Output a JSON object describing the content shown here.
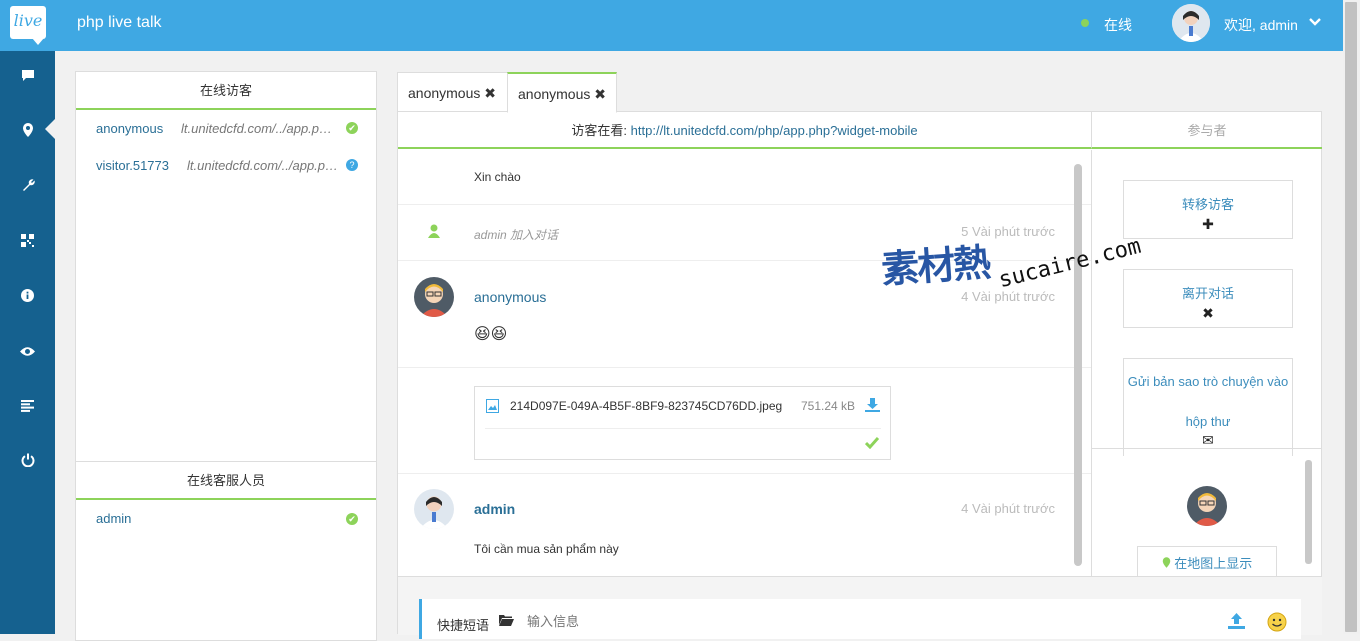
{
  "header": {
    "logo": "live",
    "title": "php live talk",
    "status": "在线",
    "welcome": "欢迎, admin"
  },
  "sidebar": {
    "icons": [
      "chat-icon",
      "map-pin-icon",
      "wrench-icon",
      "qrcode-icon",
      "info-icon",
      "eye-icon",
      "list-icon",
      "power-icon"
    ]
  },
  "visitors_panel": {
    "title": "在线访客",
    "rows": [
      {
        "name": "anonymous",
        "url": "lt.unitedcfd.com/../app.php",
        "status": "online"
      },
      {
        "name": "visitor.51773",
        "url": "lt.unitedcfd.com/../app.php",
        "status": "unknown"
      }
    ]
  },
  "operators_panel": {
    "title": "在线客服人员",
    "rows": [
      {
        "name": "admin",
        "status": "online"
      }
    ]
  },
  "tabs": [
    {
      "label": "anonymous",
      "close": "✖"
    },
    {
      "label": "anonymous",
      "close": "✖"
    }
  ],
  "chat": {
    "visiting_label": "访客在看:",
    "visiting_url": "http://lt.unitedcfd.com/php/app.php?widget-mobile",
    "participants_label": "参与者",
    "messages": {
      "m1_text": "Xin chào",
      "join_text": "admin 加入对话",
      "join_time": "5 Vài phút trước",
      "m2_name": "anonymous",
      "m2_time": "4 Vài phút trước",
      "m2_emoji": "😆😆",
      "file_name": "214D097E-049A-4B5F-8BF9-823745CD76DD.jpeg",
      "file_size": "751.24 kB",
      "m3_name": "admin",
      "m3_time": "4 Vài phút trước",
      "m3_text": "Tôi cần mua sản phẩm này"
    }
  },
  "participants": {
    "transfer_label": "转移访客",
    "leave_label": "离开对话",
    "email_label_1": "Gửi bản sao trò chuyện vào",
    "email_label_2": "hộp thư",
    "map_label": "在地图上显示"
  },
  "input": {
    "quick_label": "快捷短语",
    "placeholder": "输入信息"
  },
  "watermark": {
    "cn": "素材熱",
    "en": "sucaire.com"
  },
  "colors": {
    "header": "#3fa8e3",
    "sidebar": "#15618f",
    "accent_green": "#8dd35a",
    "link": "#2a6f96"
  }
}
